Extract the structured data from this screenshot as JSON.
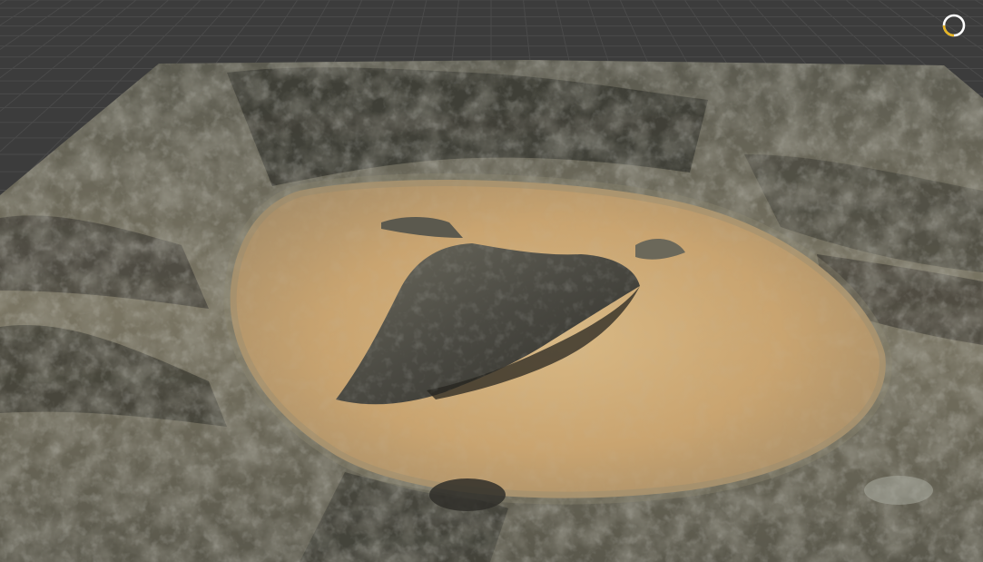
{
  "viewport": {
    "background": "#3c3c3c",
    "grid_color": "#4a4a4a",
    "terrain": {
      "rock_dark": "#3b3a33",
      "rock_mid": "#6f6a58",
      "rock_light": "#a9aa9c",
      "sand": "#c7a46e",
      "sand_light": "#d8bb84"
    }
  },
  "indicator": {
    "icon": "loading-ring-icon",
    "ring_color": "#ffffff",
    "accent_color": "#e6b422"
  }
}
